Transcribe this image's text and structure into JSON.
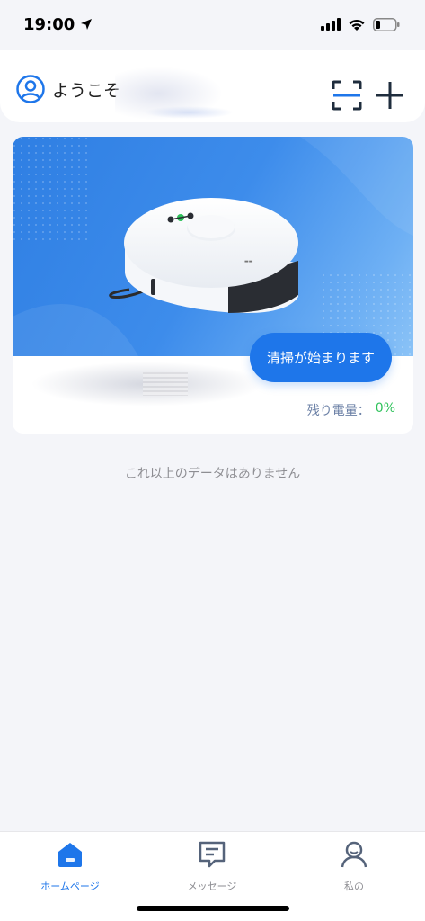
{
  "status_bar": {
    "time": "19:00",
    "icons": [
      "location-arrow-icon",
      "cellular-signal-icon",
      "wifi-icon",
      "battery-icon"
    ]
  },
  "header": {
    "welcome_text": "ようこそ",
    "scan_icon": "scan-icon",
    "add_icon": "plus-icon"
  },
  "device": {
    "start_button_label": "清掃が始まります",
    "battery_label": "残り電量：",
    "battery_value": "0%"
  },
  "list_end_text": "これ以上のデータはありません",
  "tabs": [
    {
      "label": "ホームページ",
      "icon": "home-icon",
      "active": true
    },
    {
      "label": "メッセージ",
      "icon": "message-icon",
      "active": false
    },
    {
      "label": "私の",
      "icon": "profile-icon",
      "active": false
    }
  ],
  "colors": {
    "accent": "#1e76ea",
    "battery_green": "#2fc25b",
    "background": "#f4f5f9"
  }
}
